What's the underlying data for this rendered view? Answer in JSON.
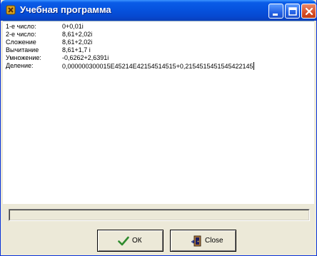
{
  "window": {
    "title": "Учебная программа"
  },
  "content": {
    "rows": [
      {
        "label": "1-е число:",
        "value": "0+0,01i"
      },
      {
        "label": "2-е число:",
        "value": "8,61+2,02i"
      },
      {
        "label": "Сложение",
        "value": "8,61+2,02i"
      },
      {
        "label": "Вычитание",
        "value": "8,61+1,7 i"
      },
      {
        "label": "Умножение:",
        "value": "-0,6262+2,6391i"
      },
      {
        "label": "Деление:",
        "value": "0,000000300015E45214E42154514515+0,2154515451545422145"
      }
    ]
  },
  "statusbar": {
    "text": ""
  },
  "buttons": {
    "ok_label": "ОК",
    "close_label": "Close"
  },
  "icons": {
    "app": "app-icon",
    "ok": "checkmark-icon",
    "close": "door-exit-icon",
    "minimize": "minimize-icon",
    "maximize": "maximize-icon",
    "window_close": "close-icon"
  },
  "colors": {
    "titlebar": "#0653df",
    "ok_check": "#2e8b2e",
    "close_button": "#d9502b"
  }
}
